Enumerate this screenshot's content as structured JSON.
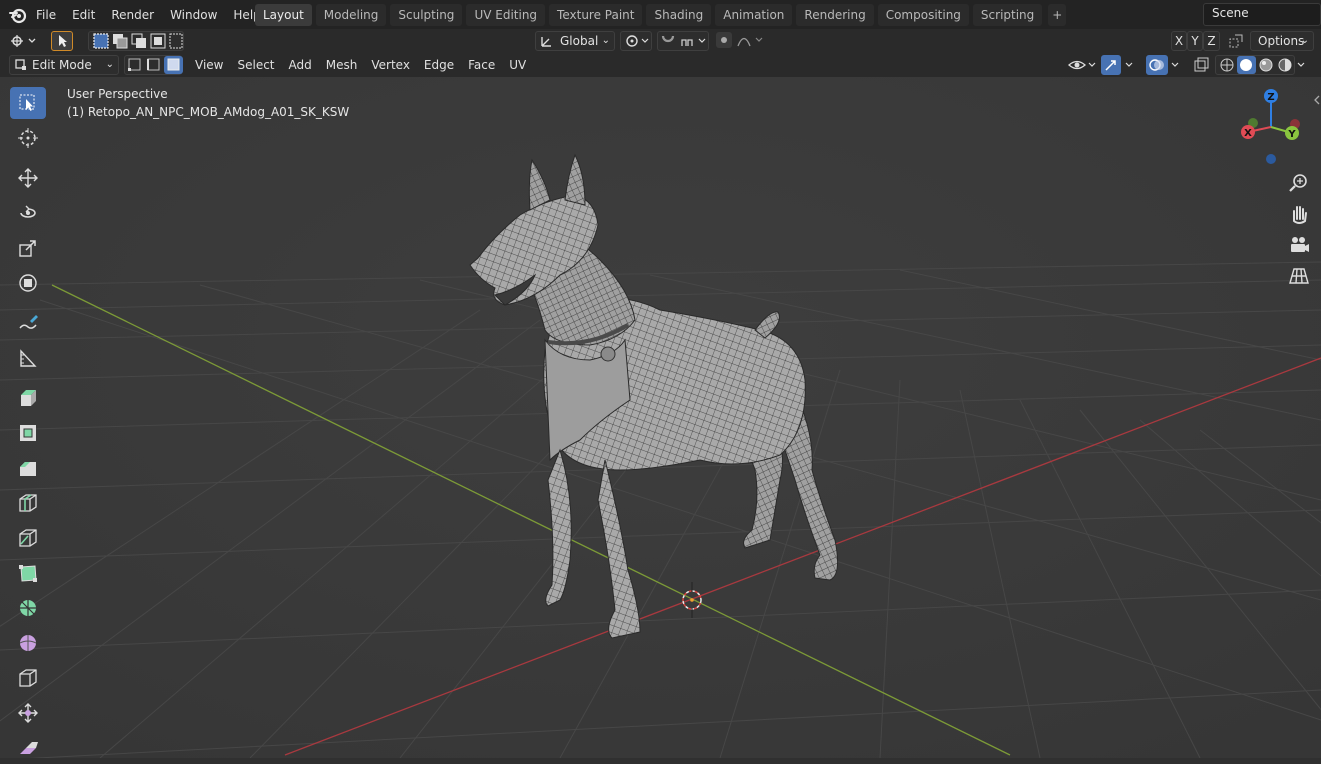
{
  "topbar": {
    "menus": [
      "File",
      "Edit",
      "Render",
      "Window",
      "Help"
    ],
    "workspaces": [
      "Layout",
      "Modeling",
      "Sculpting",
      "UV Editing",
      "Texture Paint",
      "Shading",
      "Animation",
      "Rendering",
      "Compositing",
      "Scripting"
    ],
    "active_workspace": "Layout",
    "add_tab": "+",
    "scene_name": "Scene"
  },
  "header": {
    "transform_orientation": "Global",
    "axis_x": "X",
    "axis_y": "Y",
    "axis_z": "Z",
    "options": "Options"
  },
  "edit_header": {
    "mode": "Edit Mode",
    "menus": [
      "View",
      "Select",
      "Add",
      "Mesh",
      "Vertex",
      "Edge",
      "Face",
      "UV"
    ]
  },
  "viewport": {
    "perspective": "User Perspective",
    "object_name": "(1) Retopo_AN_NPC_MOB_AMdog_A01_SK_KSW",
    "gizmo": {
      "z": "Z",
      "y": "Y",
      "x": "X"
    }
  },
  "colors": {
    "accent": "#4772b3",
    "x_axis": "#e04b55",
    "y_axis": "#8ac53f",
    "z_axis": "#2f7fe3"
  },
  "tools": [
    "select-box-icon",
    "cursor-icon",
    "move-icon",
    "rotate-icon",
    "scale-icon",
    "transform-icon",
    "annotate-icon",
    "measure-icon",
    "extrude-icon",
    "inset-icon",
    "bevel-icon",
    "loop-cut-icon",
    "knife-icon",
    "poly-build-icon",
    "spin-icon",
    "smooth-icon",
    "edge-slide-icon",
    "shrink-fatten-icon",
    "shear-icon"
  ]
}
